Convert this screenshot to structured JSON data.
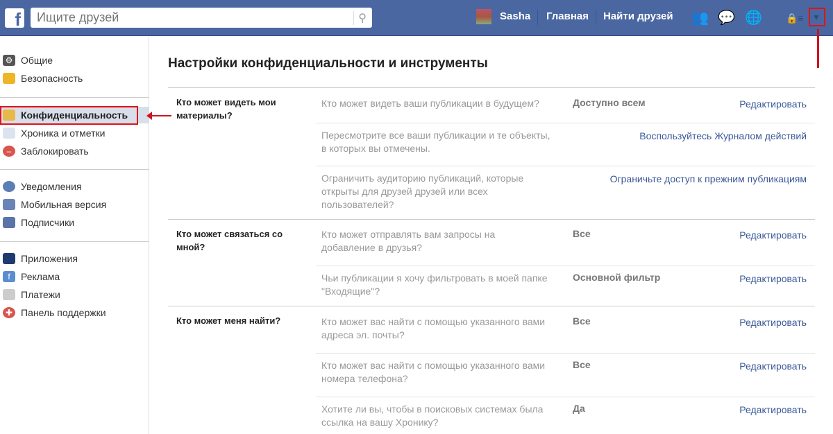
{
  "header": {
    "search_placeholder": "Ищите друзей",
    "user": "Sasha",
    "home": "Главная",
    "find_friends": "Найти друзей"
  },
  "sidebar": {
    "items": [
      {
        "label": "Общие",
        "icon": "gears-icon"
      },
      {
        "label": "Безопасность",
        "icon": "shield-icon"
      },
      {
        "label": "Конфиденциальность",
        "icon": "lock-icon"
      },
      {
        "label": "Хроника и отметки",
        "icon": "timeline-icon"
      },
      {
        "label": "Заблокировать",
        "icon": "block-icon"
      },
      {
        "label": "Уведомления",
        "icon": "globe-icon"
      },
      {
        "label": "Мобильная версия",
        "icon": "mobile-icon"
      },
      {
        "label": "Подписчики",
        "icon": "rss-icon"
      },
      {
        "label": "Приложения",
        "icon": "apps-icon"
      },
      {
        "label": "Реклама",
        "icon": "ads-icon"
      },
      {
        "label": "Платежи",
        "icon": "card-icon"
      },
      {
        "label": "Панель поддержки",
        "icon": "lifebuoy-icon"
      }
    ]
  },
  "main": {
    "title": "Настройки конфиденциальности и инструменты",
    "sections": [
      {
        "title": "Кто может видеть мои материалы?",
        "rows": [
          {
            "q": "Кто может видеть ваши публикации в будущем?",
            "v": "Доступно всем",
            "link": "Редактировать"
          },
          {
            "q": "Пересмотрите все ваши публикации и те объекты, в которых вы отмечены.",
            "v": "",
            "link": "Воспользуйтесь Журналом действий"
          },
          {
            "q": "Ограничить аудиторию публикаций, которые открыты для друзей друзей или всех пользователей?",
            "v": "",
            "link": "Ограничьте доступ к прежним публикациям"
          }
        ]
      },
      {
        "title": "Кто может связаться со мной?",
        "rows": [
          {
            "q": "Кто может отправлять вам запросы на добавление в друзья?",
            "v": "Все",
            "link": "Редактировать"
          },
          {
            "q": "Чьи публикации я хочу фильтровать в моей папке \"Входящие\"?",
            "v": "Основной фильтр",
            "link": "Редактировать"
          }
        ]
      },
      {
        "title": "Кто может меня найти?",
        "rows": [
          {
            "q": "Кто может вас найти с помощью указанного вами адреса эл. почты?",
            "v": "Все",
            "link": "Редактировать"
          },
          {
            "q": "Кто может вас найти с помощью указанного вами номера телефона?",
            "v": "Все",
            "link": "Редактировать"
          },
          {
            "q": "Хотите ли вы, чтобы в поисковых системах была ссылка на вашу Хронику?",
            "v": "Да",
            "link": "Редактировать"
          }
        ]
      }
    ]
  }
}
